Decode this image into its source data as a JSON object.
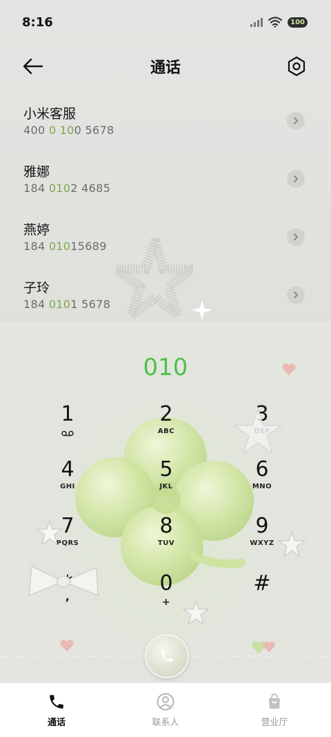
{
  "status_bar": {
    "time": "8:16",
    "battery": "100"
  },
  "header": {
    "title": "通话",
    "back_icon": "arrow-left-icon",
    "settings_icon": "hexagon-gear-icon"
  },
  "contacts": [
    {
      "name": "小米客服",
      "number_parts": [
        "400 ",
        "0 10",
        "0 5678"
      ]
    },
    {
      "name": "雅娜",
      "number_parts": [
        "184 ",
        "010",
        "2 4685"
      ]
    },
    {
      "name": "燕婷",
      "number_parts": [
        "184 ",
        "010",
        "15689"
      ]
    },
    {
      "name": "子玲",
      "number_parts": [
        "184 ",
        "010",
        "1 5678"
      ]
    }
  ],
  "dialer": {
    "input": "010",
    "keys": [
      {
        "digit": "1",
        "letters": ""
      },
      {
        "digit": "2",
        "letters": "ABC"
      },
      {
        "digit": "3",
        "letters": "DEF"
      },
      {
        "digit": "4",
        "letters": "GHI"
      },
      {
        "digit": "5",
        "letters": "JKL"
      },
      {
        "digit": "6",
        "letters": "MNO"
      },
      {
        "digit": "7",
        "letters": "PQRS"
      },
      {
        "digit": "8",
        "letters": "TUV"
      },
      {
        "digit": "9",
        "letters": "WXYZ"
      },
      {
        "digit": "*",
        "letters": ","
      },
      {
        "digit": "0",
        "letters": "+"
      },
      {
        "digit": "#",
        "letters": ""
      }
    ],
    "call_icon": "phone-icon"
  },
  "bottom_nav": [
    {
      "label": "通话",
      "icon": "phone-icon",
      "active": true
    },
    {
      "label": "联系人",
      "icon": "person-icon",
      "active": false
    },
    {
      "label": "营业厅",
      "icon": "shopping-bag-icon",
      "active": false
    }
  ],
  "colors": {
    "accent_green": "#4fbf49",
    "number_highlight": "#7da74c"
  }
}
